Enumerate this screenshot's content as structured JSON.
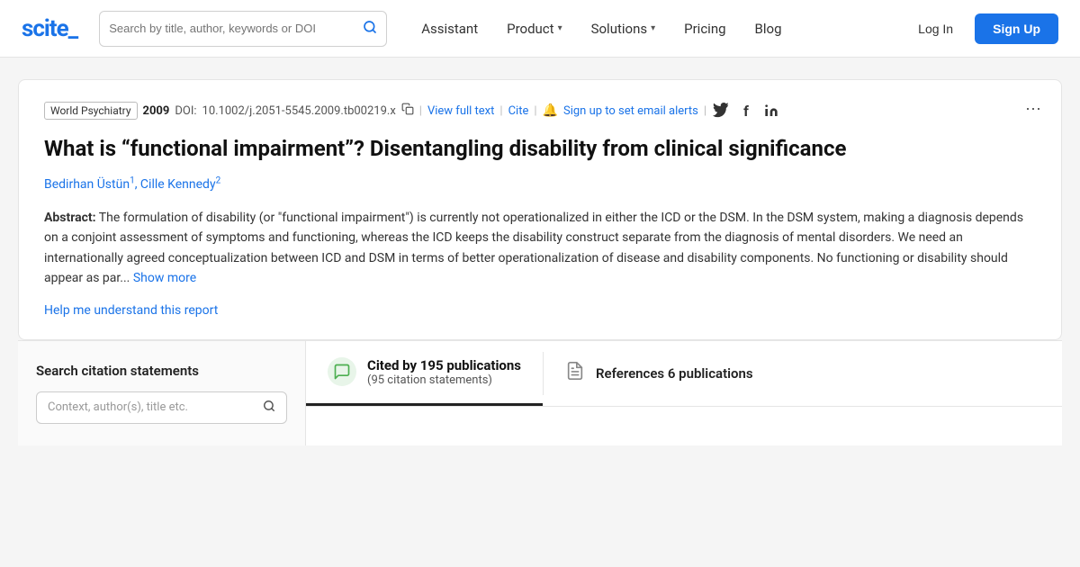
{
  "logo": {
    "text": "scite_"
  },
  "nav": {
    "search_placeholder": "Search by title, author, keywords or DOI",
    "items": [
      {
        "label": "Assistant",
        "has_dropdown": false
      },
      {
        "label": "Product",
        "has_dropdown": true
      },
      {
        "label": "Solutions",
        "has_dropdown": true
      },
      {
        "label": "Pricing",
        "has_dropdown": false
      },
      {
        "label": "Blog",
        "has_dropdown": false
      }
    ],
    "login_label": "Log In",
    "signup_label": "Sign Up"
  },
  "article": {
    "journal": "World Psychiatry",
    "year": "2009",
    "doi_label": "DOI:",
    "doi": "10.1002/j.2051-5545.2009.tb00219.x",
    "view_full_text": "View full text",
    "cite": "Cite",
    "alert_text": "Sign up to set email alerts",
    "title": "What is “functional impairment”? Disentangling disability from clinical significance",
    "authors": [
      {
        "name": "Bedirhan Üstün",
        "sup": "1"
      },
      {
        "name": "Cille Kennedy",
        "sup": "2"
      }
    ],
    "abstract_label": "Abstract:",
    "abstract": "The formulation of disability (or \"functional impairment\") is currently not operationalized in either the ICD or the DSM. In the DSM system, making a diagnosis depends on a conjoint assessment of symptoms and functioning, whereas the ICD keeps the disability construct separate from the diagnosis of mental disorders. We need an internationally agreed conceptualization between ICD and DSM in terms of better operationalization of disease and disability components. No functioning or disability should appear as par...",
    "show_more": "Show more",
    "help_link": "Help me understand this report",
    "more_icon": "⋯"
  },
  "bottom": {
    "sidebar": {
      "title": "Search citation statements",
      "input_placeholder": "Context, author(s), title etc."
    },
    "citations_tab": {
      "count": "195",
      "label": "Cited by 195 publications",
      "sublabel": "(95 citation statements)",
      "icon": "💬"
    },
    "references_tab": {
      "label": "References 6 publications",
      "icon": "📋"
    }
  }
}
